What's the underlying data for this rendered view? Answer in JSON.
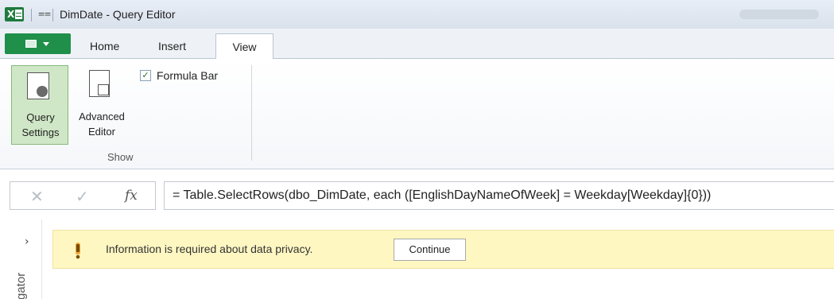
{
  "window": {
    "title": "DimDate - Query Editor",
    "app_icon": "excel-icon",
    "qat_glyph": "⩵"
  },
  "tabs": {
    "home": "Home",
    "insert": "Insert",
    "view": "View",
    "active": "View"
  },
  "ribbon": {
    "query_settings": {
      "line1": "Query",
      "line2": "Settings"
    },
    "advanced_editor": {
      "line1": "Advanced",
      "line2": "Editor"
    },
    "formula_bar_checkbox": {
      "label": "Formula Bar",
      "checked": true,
      "glyph": "✓"
    },
    "group_label": "Show"
  },
  "formula_bar": {
    "cancel_glyph": "✕",
    "confirm_glyph": "✓",
    "fx_label": "fx",
    "formula": "= Table.SelectRows(dbo_DimDate, each ([EnglishDayNameOfWeek] = Weekday[Weekday]{0}))"
  },
  "navigator": {
    "label": "gator",
    "chevron": "›"
  },
  "privacy_notice": {
    "message": "Information is required about data privacy.",
    "button_label": "Continue",
    "icon": "warning-icon"
  },
  "colors": {
    "accent_green": "#1f8f4a",
    "notice_bg": "#fff7c2",
    "selected_button_bg": "#cfe7c6"
  }
}
